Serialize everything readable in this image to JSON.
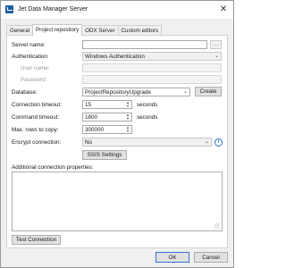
{
  "window": {
    "title": "Jet Data Manager Server",
    "close_glyph": "✕"
  },
  "tabs": [
    {
      "label": "General",
      "active": false
    },
    {
      "label": "Project repository",
      "active": true
    },
    {
      "label": "ODX Server",
      "active": false
    },
    {
      "label": "Custom editors",
      "active": false
    }
  ],
  "form": {
    "server_name": {
      "label": "Server name:",
      "value": ""
    },
    "browse_label": "...",
    "authentication": {
      "label": "Authentication:",
      "value": "Windows Authentication"
    },
    "user_name": {
      "label": "User name:",
      "value": ""
    },
    "password": {
      "label": "Password:",
      "value": ""
    },
    "database": {
      "label": "Database:",
      "value": "ProjectRepositoryUpgrade"
    },
    "create_label": "Create",
    "connection_timeout": {
      "label": "Connection timeout:",
      "value": "15",
      "unit": "seconds"
    },
    "command_timeout": {
      "label": "Command timeout:",
      "value": "1800",
      "unit": "seconds"
    },
    "max_rows": {
      "label": "Max. rows to copy:",
      "value": "300000"
    },
    "encrypt": {
      "label": "Encrypt connection:",
      "value": "No"
    },
    "ssis_settings_label": "SSIS Settings",
    "additional_props_label": "Additional connection properties:",
    "test_connection_label": "Test Connection"
  },
  "footer": {
    "ok_label": "OK",
    "cancel_label": "Cancel"
  },
  "icons": {
    "app": "jet-data-manager-icon",
    "info": "info-icon",
    "info_glyph": "i",
    "dropdown_glyph": "⌄",
    "spin_up_glyph": "▲",
    "spin_down_glyph": "▼"
  }
}
